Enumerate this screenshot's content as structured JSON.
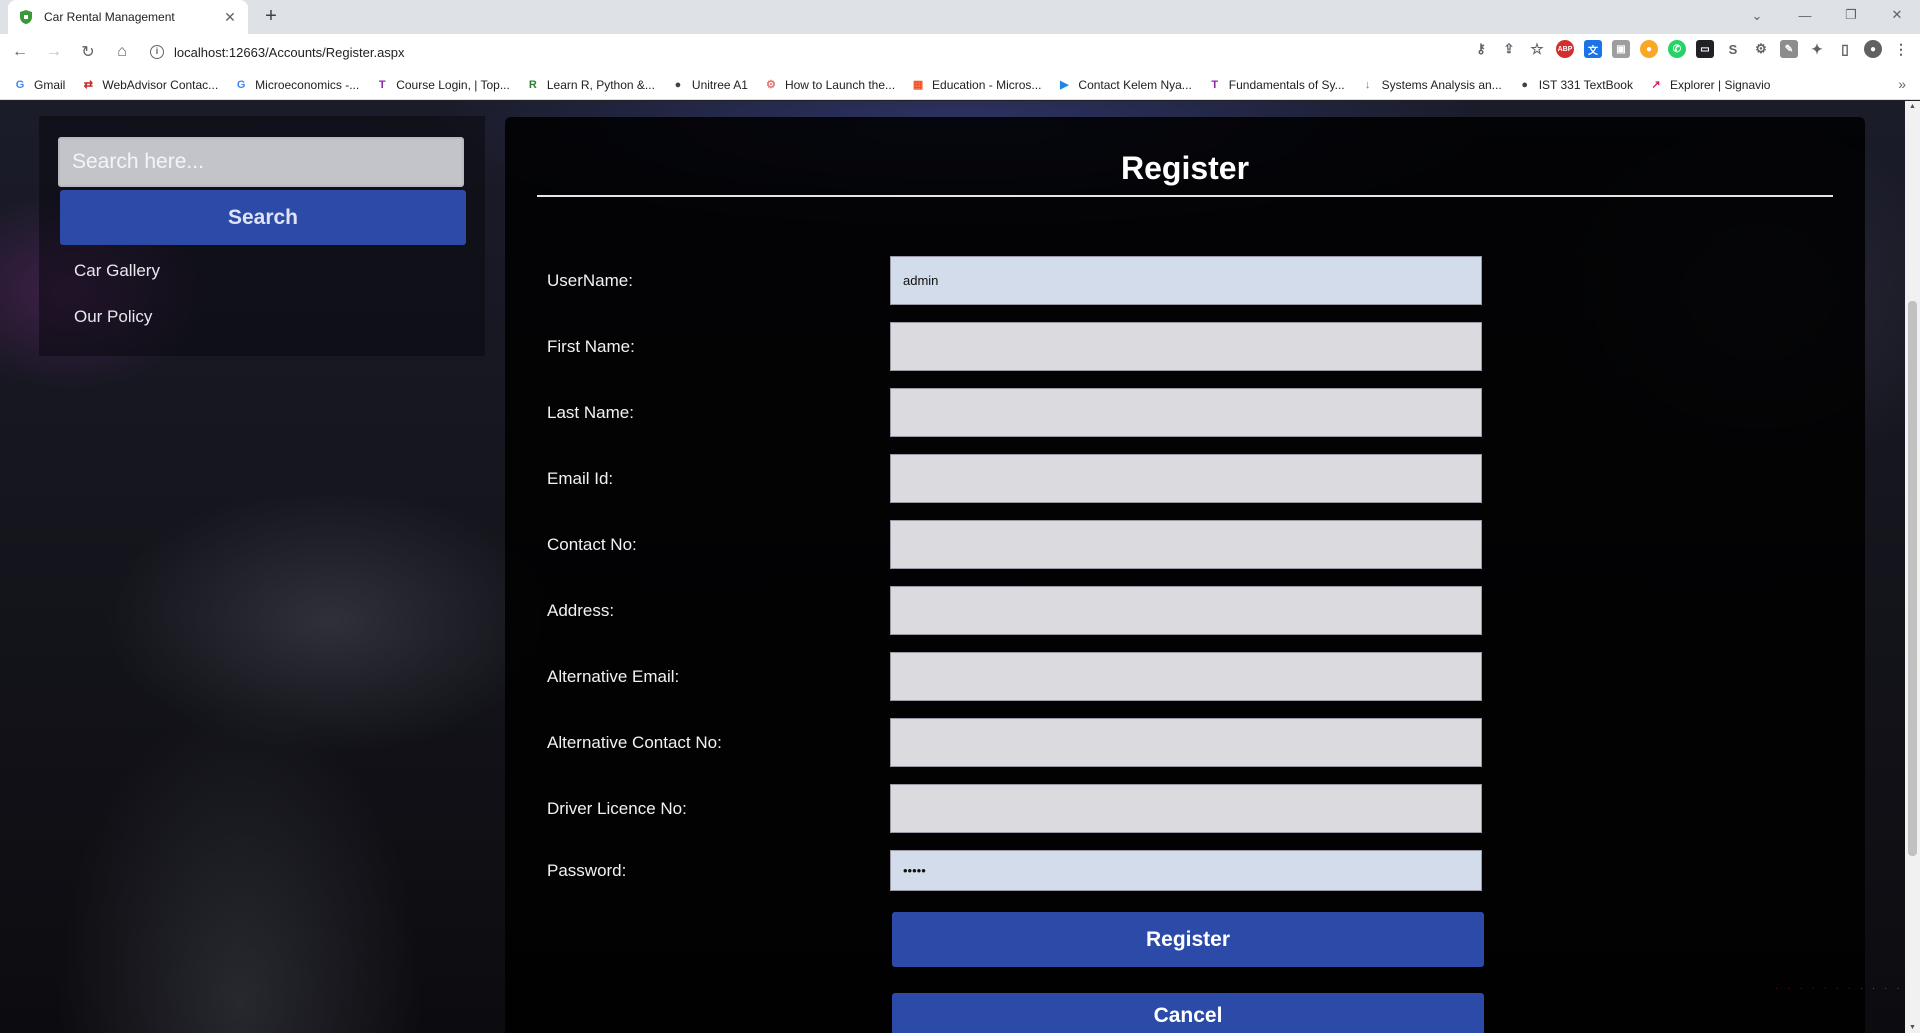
{
  "browser": {
    "tab_title": "Car Rental Management",
    "new_tab": "+",
    "url": "localhost:12663/Accounts/Register.aspx",
    "bookmarks": [
      {
        "label": "Gmail",
        "icon": "G",
        "color": "#4285f4"
      },
      {
        "label": "WebAdvisor Contac...",
        "icon": "⇄",
        "color": "#c62828"
      },
      {
        "label": "Microeconomics -...",
        "icon": "G",
        "color": "#4285f4"
      },
      {
        "label": "Course Login, | Top...",
        "icon": "T",
        "color": "#8e24aa"
      },
      {
        "label": "Learn R, Python &...",
        "icon": "R",
        "color": "#2e7d32"
      },
      {
        "label": "Unitree A1",
        "icon": "●",
        "color": "#424242"
      },
      {
        "label": "How to Launch the...",
        "icon": "⚙",
        "color": "#e57373"
      },
      {
        "label": "Education - Micros...",
        "icon": "▦",
        "color": "#f25022"
      },
      {
        "label": "Contact Kelem Nya...",
        "icon": "▶",
        "color": "#1e88e5"
      },
      {
        "label": "Fundamentals of Sy...",
        "icon": "T",
        "color": "#8e24aa"
      },
      {
        "label": "Systems Analysis an...",
        "icon": "↓",
        "color": "#1e88e5"
      },
      {
        "label": "IST 331 TextBook",
        "icon": "●",
        "color": "#424242"
      },
      {
        "label": "Explorer | Signavio",
        "icon": "↗",
        "color": "#d81b60"
      }
    ]
  },
  "sidebar": {
    "search_placeholder": "Search here...",
    "search_button": "Search",
    "links": [
      "Car Gallery",
      "Our Policy"
    ]
  },
  "register": {
    "title": "Register",
    "fields": [
      {
        "label": "UserName:",
        "value": "admin"
      },
      {
        "label": "First Name:",
        "value": ""
      },
      {
        "label": "Last Name:",
        "value": ""
      },
      {
        "label": "Email Id:",
        "value": ""
      },
      {
        "label": "Contact No:",
        "value": ""
      },
      {
        "label": "Address:",
        "value": ""
      },
      {
        "label": "Alternative Email:",
        "value": ""
      },
      {
        "label": "Alternative Contact No:",
        "value": ""
      },
      {
        "label": "Driver Licence No:",
        "value": ""
      },
      {
        "label": "Password:",
        "value": "•••••"
      }
    ],
    "register_button": "Register",
    "cancel_button": "Cancel"
  },
  "colors": {
    "button_blue": "#2c4ba8",
    "panel_background": "#000000"
  }
}
